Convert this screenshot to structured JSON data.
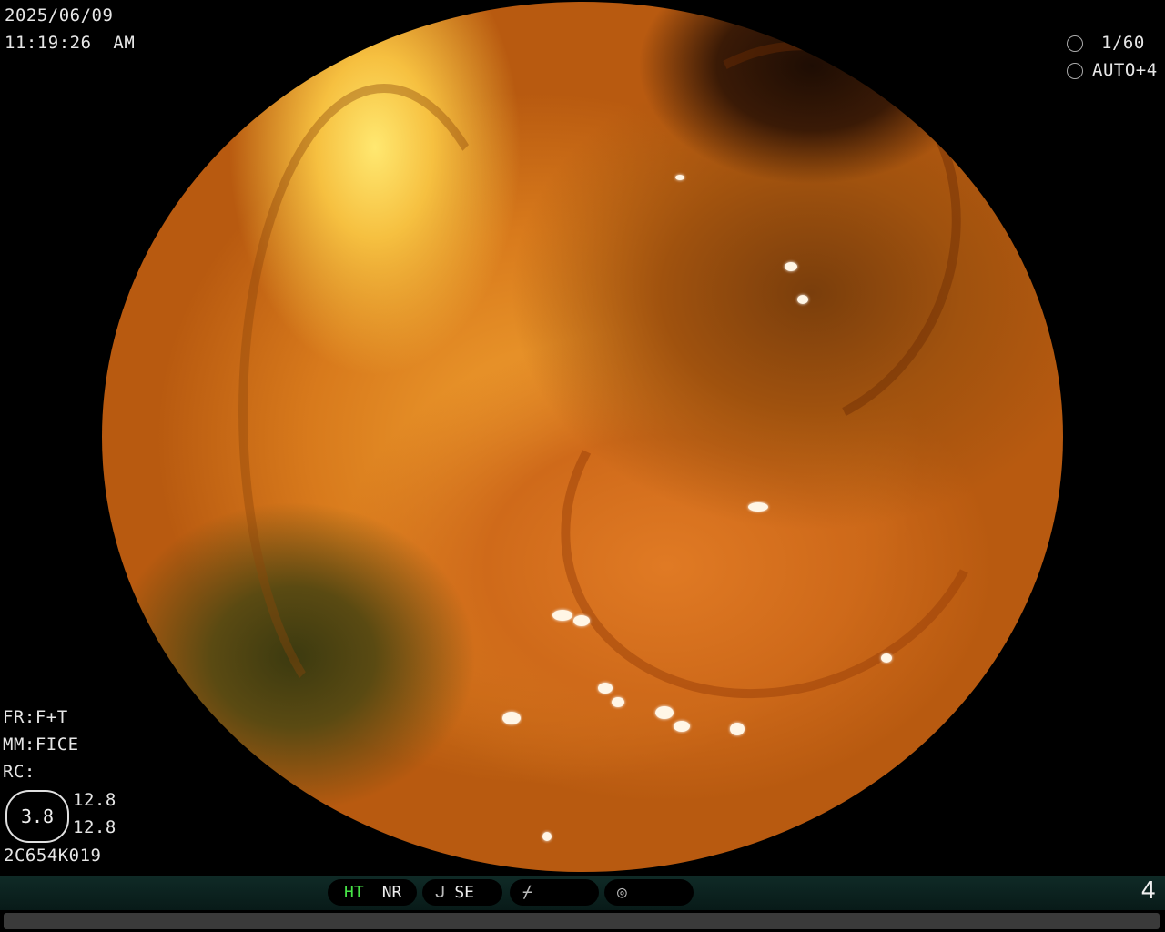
{
  "datetime": {
    "date": "2025/06/09",
    "time": "11:19:26  AM"
  },
  "exposure": {
    "shutter": "1/60",
    "iris": "AUTO+4",
    "shutter_icon": "aperture-icon",
    "iris_icon": "gear-icon"
  },
  "settings": {
    "fr": "FR:F+T",
    "mm": "MM:FICE",
    "rc": "RC:"
  },
  "zoom": {
    "value": "3.8",
    "top": "12.8",
    "bottom": "12.8"
  },
  "scope_id": "2C654K019",
  "status_bar": {
    "ht": "HT",
    "nr": "NR",
    "se": "SE",
    "se_icon": "curve-icon",
    "slash_icon": "slash-icon",
    "circle_icon": "wave-circle-icon",
    "page": "4"
  },
  "colors": {
    "ht_active": "#46e446",
    "bar_bg": "#0f2a26"
  }
}
